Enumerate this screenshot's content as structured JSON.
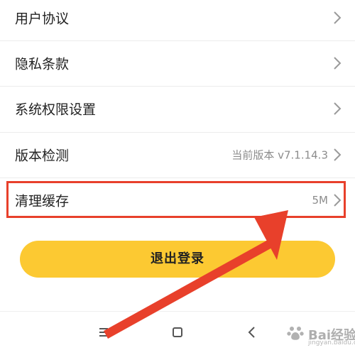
{
  "settings": {
    "items": [
      {
        "label": "用户协议",
        "value": ""
      },
      {
        "label": "隐私条款",
        "value": ""
      },
      {
        "label": "系统权限设置",
        "value": ""
      },
      {
        "label": "版本检测",
        "value": "当前版本 v7.1.14.3"
      },
      {
        "label": "清理缓存",
        "value": "5M"
      }
    ]
  },
  "logout": {
    "label": "退出登录"
  },
  "navbar": {
    "icons": [
      "menu-icon",
      "home-square-icon",
      "back-icon"
    ]
  },
  "annotation": {
    "highlight_color": "#e8402b",
    "arrow_color": "#e8402b"
  },
  "watermark": {
    "text": "Bai经验",
    "sub": "jingyan.baidu.com"
  },
  "colors": {
    "button": "#fcc932",
    "accent": "#e8402b",
    "text": "#222222",
    "secondary": "#8c8c8c"
  }
}
